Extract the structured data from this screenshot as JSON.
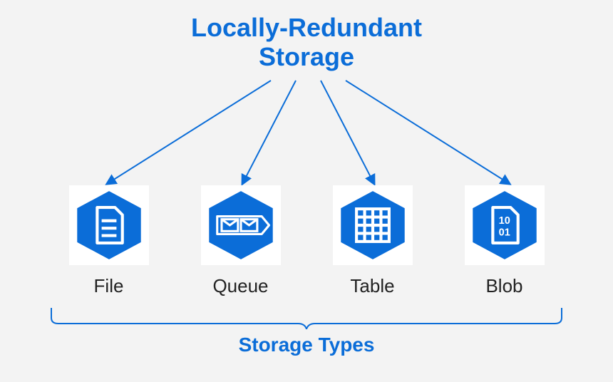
{
  "title_line1": "Locally-Redundant",
  "title_line2": "Storage",
  "items": [
    {
      "label": "File"
    },
    {
      "label": "Queue"
    },
    {
      "label": "Table"
    },
    {
      "label": "Blob"
    }
  ],
  "footer_label": "Storage Types",
  "colors": {
    "brand": "#0b6dd8",
    "tile_bg": "#ffffff",
    "bg": "#f3f3f3"
  }
}
